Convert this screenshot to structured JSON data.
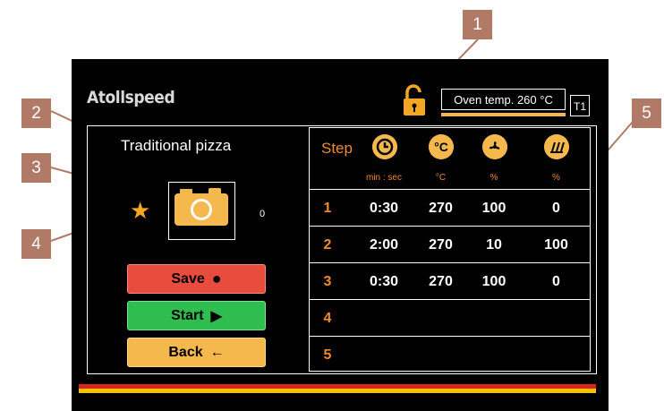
{
  "brand": "Atollspeed",
  "header": {
    "oven_temp": "Oven temp. 260 °C",
    "tray": "T1"
  },
  "recipe": {
    "name": "Traditional pizza",
    "favorite_count": "0"
  },
  "buttons": {
    "save": "Save",
    "save_icon": "●",
    "start": "Start",
    "start_icon": "▶",
    "back": "Back",
    "back_icon": "←"
  },
  "table": {
    "step_label": "Step",
    "columns": [
      {
        "icon": "clock-icon",
        "unit": "min : sec"
      },
      {
        "icon": "celsius-icon",
        "unit": "°C"
      },
      {
        "icon": "fan-icon",
        "unit": "%"
      },
      {
        "icon": "heat-icon",
        "unit": "%"
      }
    ],
    "rows": [
      {
        "step": "1",
        "time": "0:30",
        "temp": "270",
        "fan": "100",
        "heat": "0"
      },
      {
        "step": "2",
        "time": "2:00",
        "temp": "270",
        "fan": "10",
        "heat": "100"
      },
      {
        "step": "3",
        "time": "0:30",
        "temp": "270",
        "fan": "100",
        "heat": "0"
      },
      {
        "step": "4",
        "time": "",
        "temp": "",
        "fan": "",
        "heat": ""
      },
      {
        "step": "5",
        "time": "",
        "temp": "",
        "fan": "",
        "heat": ""
      }
    ]
  },
  "callouts": [
    "1",
    "2",
    "3",
    "4",
    "5"
  ],
  "colors": {
    "accent_orange": "#f08a2e",
    "save_red": "#e74c3c",
    "start_green": "#2ebd4e",
    "back_yellow": "#f5b84d",
    "callout_brown": "#b07a66"
  }
}
